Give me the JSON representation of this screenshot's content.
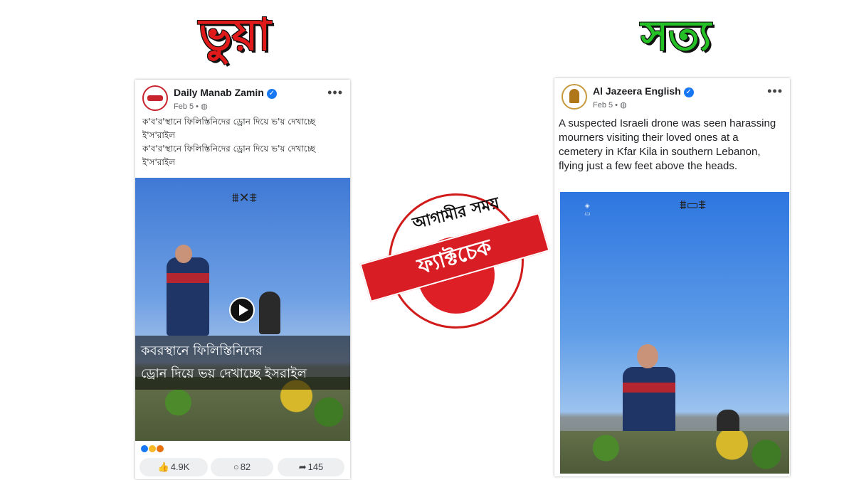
{
  "headings": {
    "fake": "ভুয়া",
    "true": "সত্য"
  },
  "left_post": {
    "page_name": "Daily Manab Zamin",
    "date": "Feb 5 •",
    "caption_line1": "ক'ব'র'স্থানে ফিলিস্তিনিদের ড্রোন দিয়ে ভ'য় দেখাচ্ছে ই'স'রাইল",
    "caption_line2": "ক'ব'র'স্থানে ফিলিস্তিনিদের ড্রোন দিয়ে ভ'য় দেখাচ্ছে ই'স'রাইল",
    "video_overlay_line1": "কবরস্থানে ফিলিস্তিনিদের",
    "video_overlay_line2": "ড্রোন দিয়ে ভয় দেখাচ্ছে ইসরাইল",
    "likes": "4.9K",
    "comments": "82",
    "shares": "145"
  },
  "right_post": {
    "page_name": "Al Jazeera English",
    "date": "Feb 5 •",
    "caption": "A suspected Israeli drone was seen harassing mourners visiting their loved ones at a cemetery in Kfar Kila in southern Lebanon, flying just a few feet above the heads."
  },
  "stamp": {
    "top_text": "আগামীর সময়",
    "ribbon_text": "ফ্যাক্টচেক"
  },
  "colors": {
    "fake": "#e01a1a",
    "true": "#25c025",
    "facebook_blue": "#1877f2",
    "stamp_red": "#de1f26"
  },
  "icons": [
    "verified-badge-icon",
    "globe-icon",
    "more-options-icon",
    "play-icon",
    "drone-icon",
    "like-icon",
    "comment-icon",
    "share-icon"
  ]
}
